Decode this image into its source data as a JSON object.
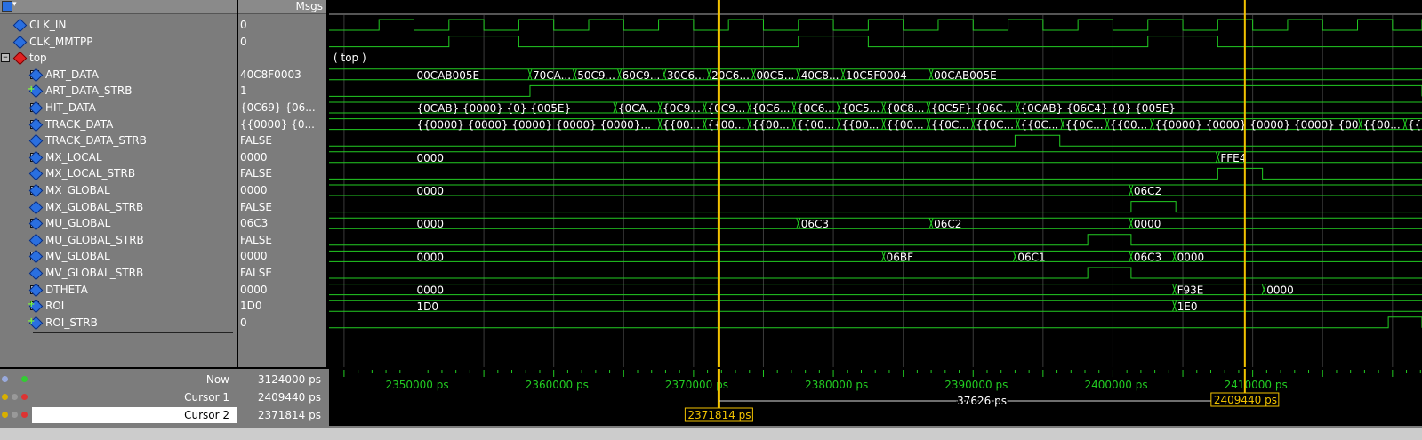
{
  "header": {
    "msgs_label": "Msgs"
  },
  "signals": [
    {
      "name": "CLK_IN",
      "value": "0",
      "expandable": false,
      "icon": "diamond-blue"
    },
    {
      "name": "CLK_MMTPP",
      "value": "0",
      "expandable": false,
      "icon": "diamond-blue"
    },
    {
      "name": "top",
      "value": "",
      "expandable": true,
      "expanded": true,
      "icon": "diamond-red"
    },
    {
      "name": "ART_DATA",
      "value": "40C8F0003",
      "expandable": true,
      "icon": "diamond-blue"
    },
    {
      "name": "ART_DATA_STRB",
      "value": "1",
      "expandable": false,
      "icon": "diamond-blue-plus"
    },
    {
      "name": "HIT_DATA",
      "value": "{0C69} {06...",
      "expandable": true,
      "icon": "diamond-blue"
    },
    {
      "name": "TRACK_DATA",
      "value": "{{0000} {0...",
      "expandable": true,
      "icon": "diamond-blue"
    },
    {
      "name": "TRACK_DATA_STRB",
      "value": "FALSE",
      "expandable": false,
      "icon": "diamond-blue"
    },
    {
      "name": "MX_LOCAL",
      "value": "0000",
      "expandable": true,
      "icon": "diamond-blue"
    },
    {
      "name": "MX_LOCAL_STRB",
      "value": "FALSE",
      "expandable": false,
      "icon": "diamond-blue"
    },
    {
      "name": "MX_GLOBAL",
      "value": "0000",
      "expandable": true,
      "icon": "diamond-blue"
    },
    {
      "name": "MX_GLOBAL_STRB",
      "value": "FALSE",
      "expandable": false,
      "icon": "diamond-blue"
    },
    {
      "name": "MU_GLOBAL",
      "value": "06C3",
      "expandable": true,
      "icon": "diamond-blue"
    },
    {
      "name": "MU_GLOBAL_STRB",
      "value": "FALSE",
      "expandable": false,
      "icon": "diamond-blue"
    },
    {
      "name": "MV_GLOBAL",
      "value": "0000",
      "expandable": true,
      "icon": "diamond-blue"
    },
    {
      "name": "MV_GLOBAL_STRB",
      "value": "FALSE",
      "expandable": false,
      "icon": "diamond-blue"
    },
    {
      "name": "DTHETA",
      "value": "0000",
      "expandable": true,
      "icon": "diamond-blue"
    },
    {
      "name": "ROI",
      "value": "1D0",
      "expandable": true,
      "icon": "diamond-blue-plus"
    },
    {
      "name": "ROI_STRB",
      "value": "0",
      "expandable": false,
      "icon": "diamond-blue-plus"
    }
  ],
  "waves": {
    "time_start_ps": 2350000,
    "time_end_ps": 2428000,
    "scope_label": "( top )",
    "clk_in": {
      "period_ps": 5000,
      "high_phase_ps": 2500
    },
    "clk_mmtpp": {
      "period_ps": 25000,
      "edges_ps": [
        2345000,
        2352500,
        2357500,
        2377500,
        2382500,
        2402500,
        2407500
      ]
    },
    "buses": {
      "ART_DATA": [
        {
          "t": 2350000,
          "label": "00CAB005E"
        },
        {
          "t": 2358300,
          "label": "70CA..."
        },
        {
          "t": 2361500,
          "label": "50C9..."
        },
        {
          "t": 2364700,
          "label": "60C9..."
        },
        {
          "t": 2367900,
          "label": "30C6..."
        },
        {
          "t": 2371100,
          "label": "20C6..."
        },
        {
          "t": 2374300,
          "label": "00C5..."
        },
        {
          "t": 2377500,
          "label": "40C8..."
        },
        {
          "t": 2380700,
          "label": "10C5F0004"
        },
        {
          "t": 2387000,
          "label": "00CAB005E"
        }
      ],
      "HIT_DATA": [
        {
          "t": 2350000,
          "label": "{0CAB} {0000} {0} {005E}"
        },
        {
          "t": 2364400,
          "label": "{0CA..."
        },
        {
          "t": 2367600,
          "label": "{0C9..."
        },
        {
          "t": 2370800,
          "label": "{0C9..."
        },
        {
          "t": 2374000,
          "label": "{0C6..."
        },
        {
          "t": 2377200,
          "label": "{0C6..."
        },
        {
          "t": 2380400,
          "label": "{0C5..."
        },
        {
          "t": 2383600,
          "label": "{0C8..."
        },
        {
          "t": 2386800,
          "label": "{0C5F} {06C..."
        },
        {
          "t": 2393200,
          "label": "{0CAB} {06C4} {0} {005E}"
        }
      ],
      "TRACK_DATA": [
        {
          "t": 2350000,
          "label": "{{0000} {0000} {0000} {0000} {0000}..."
        },
        {
          "t": 2367600,
          "label": "{{00..."
        },
        {
          "t": 2370800,
          "label": "{{00..."
        },
        {
          "t": 2374000,
          "label": "{{00..."
        },
        {
          "t": 2377200,
          "label": "{{00..."
        },
        {
          "t": 2380400,
          "label": "{{00..."
        },
        {
          "t": 2383600,
          "label": "{{00..."
        },
        {
          "t": 2386800,
          "label": "{{0C..."
        },
        {
          "t": 2390000,
          "label": "{{0C..."
        },
        {
          "t": 2393200,
          "label": "{{0C..."
        },
        {
          "t": 2396400,
          "label": "{{0C..."
        },
        {
          "t": 2399600,
          "label": "{{00..."
        },
        {
          "t": 2402800,
          "label": "{{0000} {0000} {0000} {0000} {0000} {0..."
        },
        {
          "t": 2417700,
          "label": "{{00..."
        },
        {
          "t": 2420900,
          "label": "{{00..."
        }
      ],
      "MX_LOCAL": [
        {
          "t": 2350000,
          "label": "0000"
        },
        {
          "t": 2407500,
          "label": "FFE4"
        }
      ],
      "MX_GLOBAL": [
        {
          "t": 2350000,
          "label": "0000"
        },
        {
          "t": 2401300,
          "label": "06C2"
        }
      ],
      "MU_GLOBAL": [
        {
          "t": 2350000,
          "label": "0000"
        },
        {
          "t": 2377500,
          "label": "06C3"
        },
        {
          "t": 2387000,
          "label": "06C2"
        },
        {
          "t": 2401300,
          "label": "0000"
        }
      ],
      "MV_GLOBAL": [
        {
          "t": 2350000,
          "label": "0000"
        },
        {
          "t": 2383600,
          "label": "06BF"
        },
        {
          "t": 2393000,
          "label": "06C1"
        },
        {
          "t": 2401300,
          "label": "06C3"
        },
        {
          "t": 2404400,
          "label": "0000"
        }
      ],
      "DTHETA": [
        {
          "t": 2350000,
          "label": "0000"
        },
        {
          "t": 2404400,
          "label": "F93E"
        },
        {
          "t": 2410800,
          "label": "0000"
        }
      ],
      "ROI": [
        {
          "t": 2350000,
          "label": "1D0"
        },
        {
          "t": 2404400,
          "label": "1E0"
        }
      ]
    },
    "strobes": {
      "ART_DATA_STRB": [
        [
          2358300,
          2428000
        ]
      ],
      "TRACK_DATA_STRB": [
        [
          2393000,
          2396200
        ]
      ],
      "MX_LOCAL_STRB": [
        [
          2407500,
          2410700
        ]
      ],
      "MX_GLOBAL_STRB": [
        [
          2401300,
          2404500
        ]
      ],
      "MU_GLOBAL_STRB": [
        [
          2398200,
          2401300
        ]
      ],
      "MV_GLOBAL_STRB": [
        [
          2398200,
          2401300
        ]
      ],
      "ROI_STRB": [
        [
          2419700,
          2422800
        ]
      ]
    }
  },
  "cursors": {
    "now": {
      "label": "Now",
      "value": "3124000 ps"
    },
    "cursor1": {
      "label": "Cursor 1",
      "value": "2409440 ps",
      "time_ps": 2409440
    },
    "cursor2": {
      "label": "Cursor 2",
      "value": "2371814 ps",
      "time_ps": 2371814
    },
    "delta_label": "37626 ps"
  },
  "timeline": {
    "ticks": [
      "2350000 ps",
      "2360000 ps",
      "2370000 ps",
      "2380000 ps",
      "2390000 ps",
      "2400000 ps",
      "2410000 ps"
    ],
    "tick_times_ps": [
      2350000,
      2360000,
      2370000,
      2380000,
      2390000,
      2400000,
      2410000
    ]
  },
  "colors": {
    "wave": "#22cc22",
    "cursor": "#f2c200",
    "grid": "#3a3a3a",
    "timeline_text": "#22cc22"
  }
}
